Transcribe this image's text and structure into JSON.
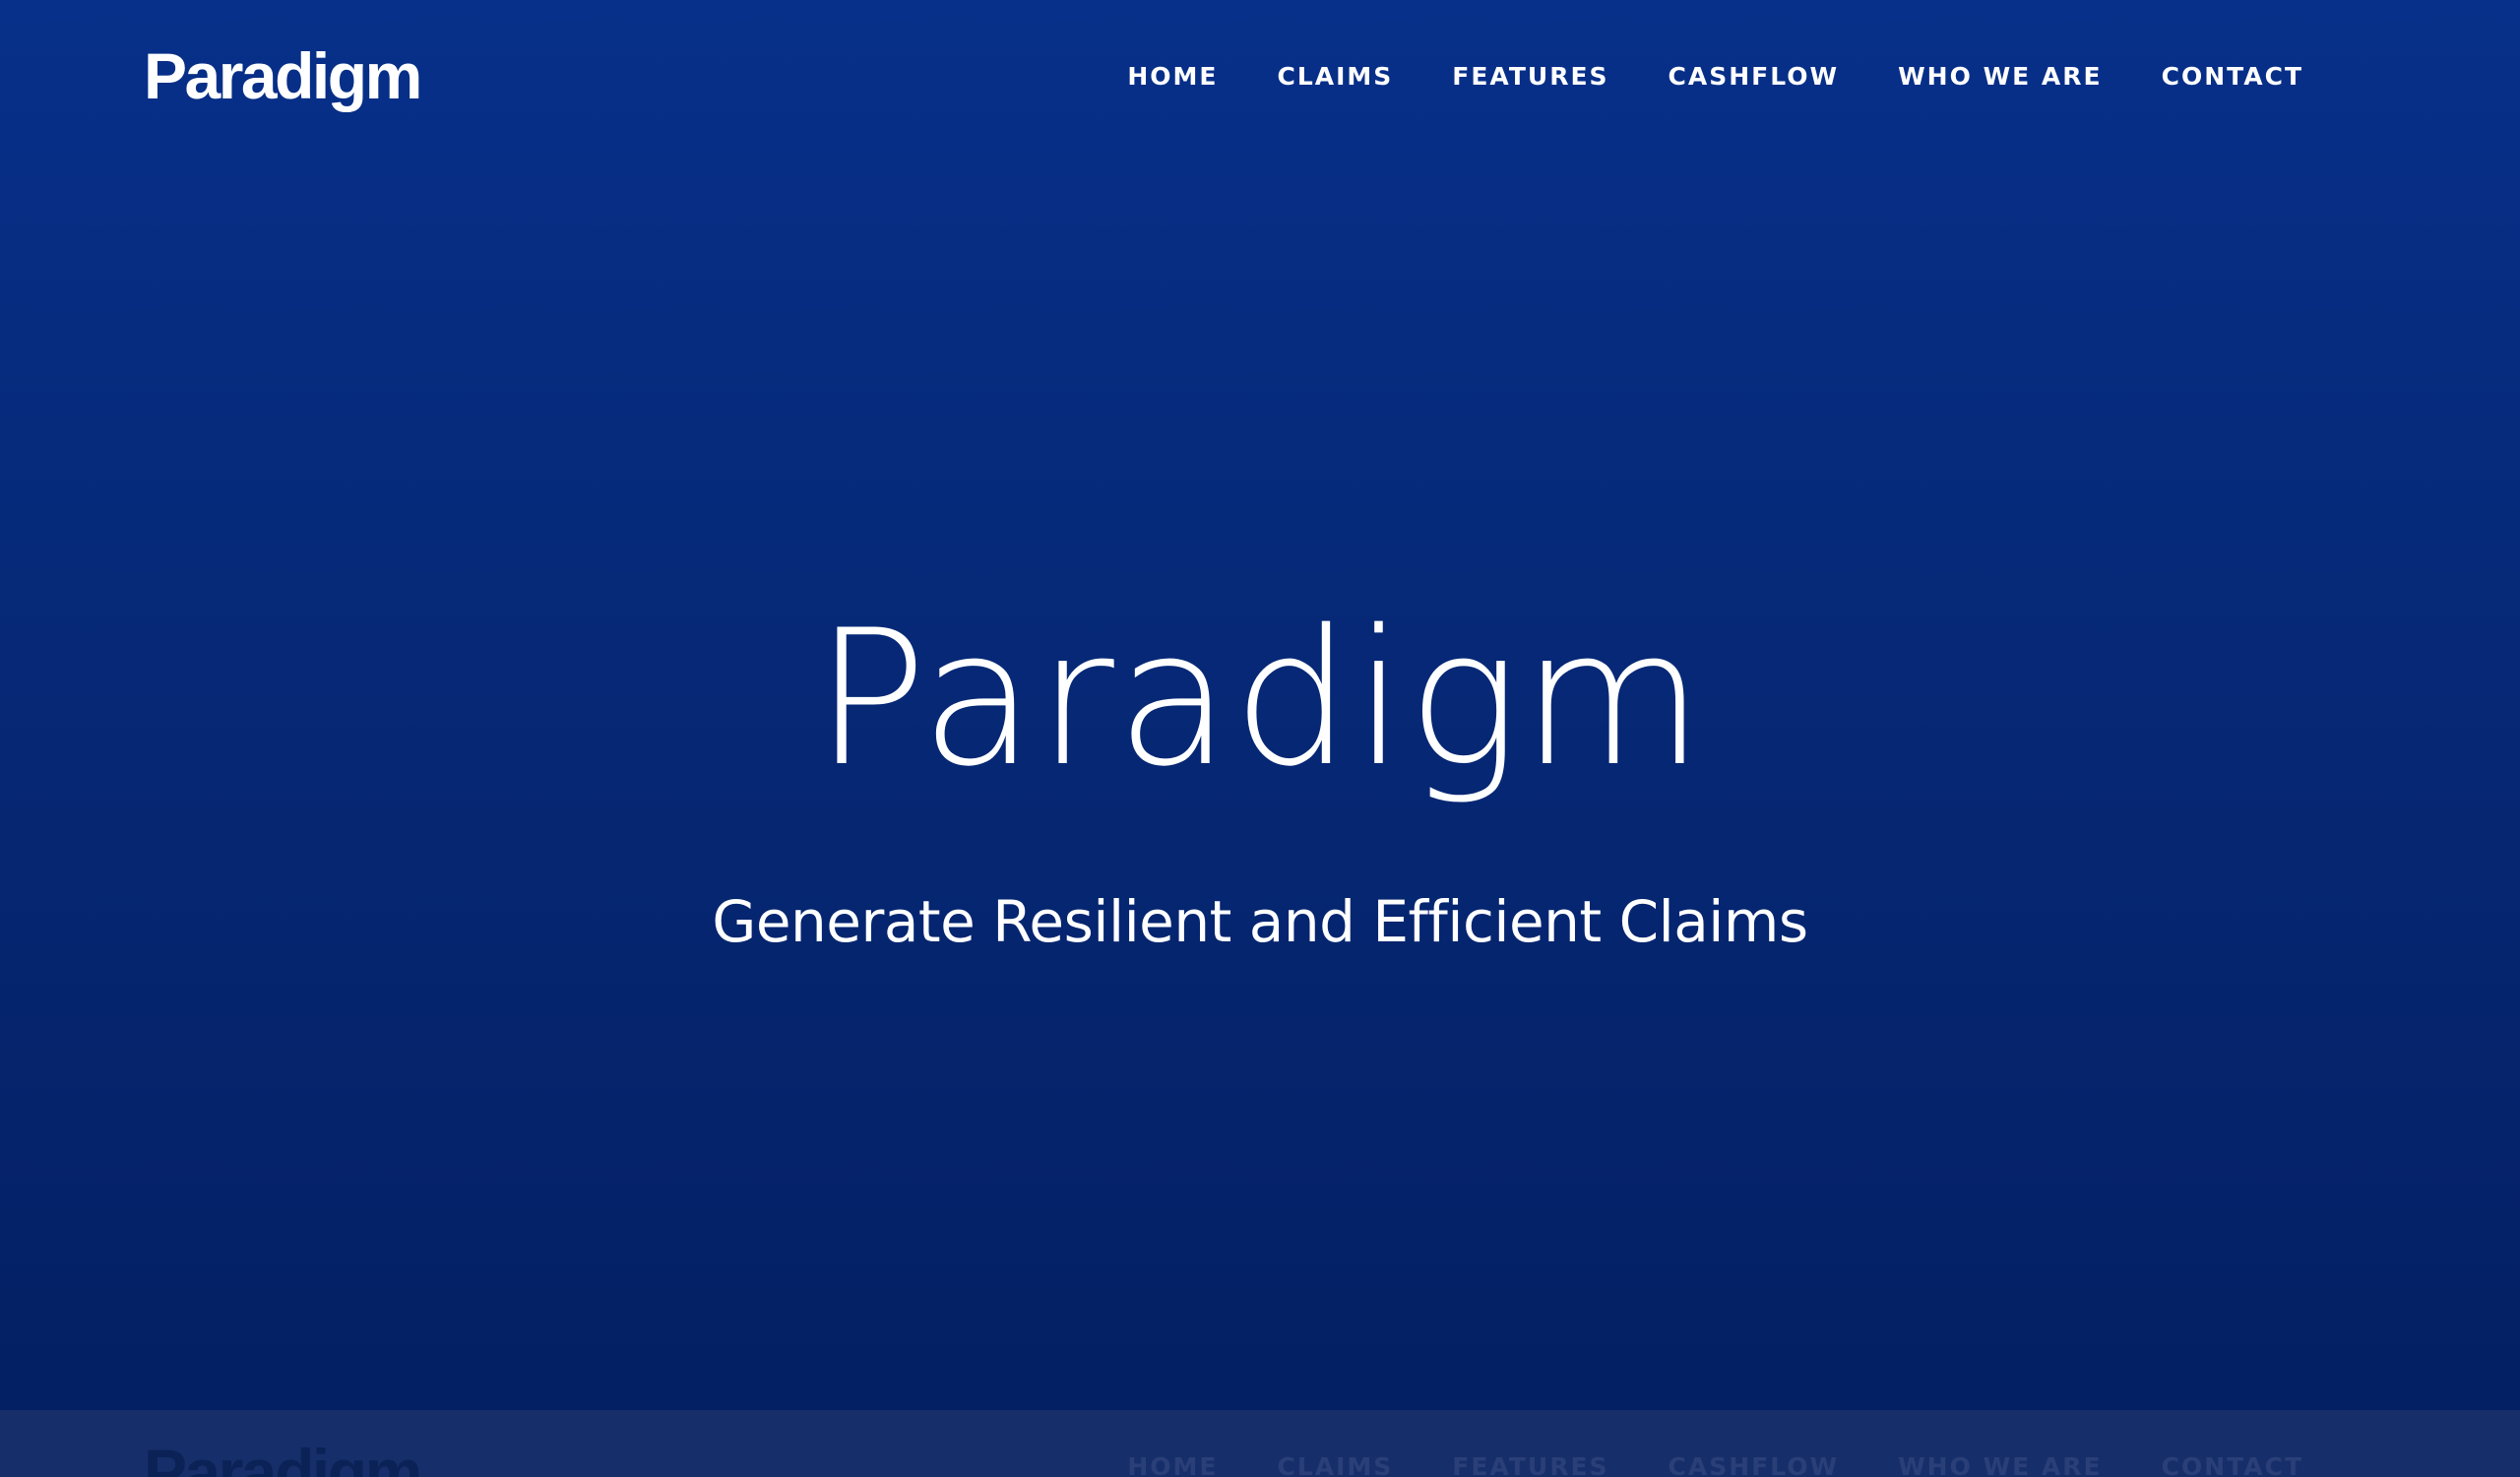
{
  "header": {
    "brand": "Paradigm",
    "nav": [
      {
        "label": "HOME"
      },
      {
        "label": "CLAIMS"
      },
      {
        "label": "FEATURES"
      },
      {
        "label": "CASHFLOW"
      },
      {
        "label": "WHO WE ARE"
      },
      {
        "label": "CONTACT"
      }
    ]
  },
  "hero": {
    "title": "Paradigm",
    "subtitle": "Generate Resilient and Efficient Claims"
  },
  "sticky_header": {
    "brand": "Paradigm",
    "nav": [
      {
        "label": "HOME"
      },
      {
        "label": "CLAIMS"
      },
      {
        "label": "FEATURES"
      },
      {
        "label": "CASHFLOW"
      },
      {
        "label": "WHO WE ARE"
      },
      {
        "label": "CONTACT"
      }
    ]
  },
  "colors": {
    "background_top": "#07308a",
    "background_bottom": "#041f62",
    "text": "#ffffff",
    "sticky_bar": "#162f6a"
  }
}
